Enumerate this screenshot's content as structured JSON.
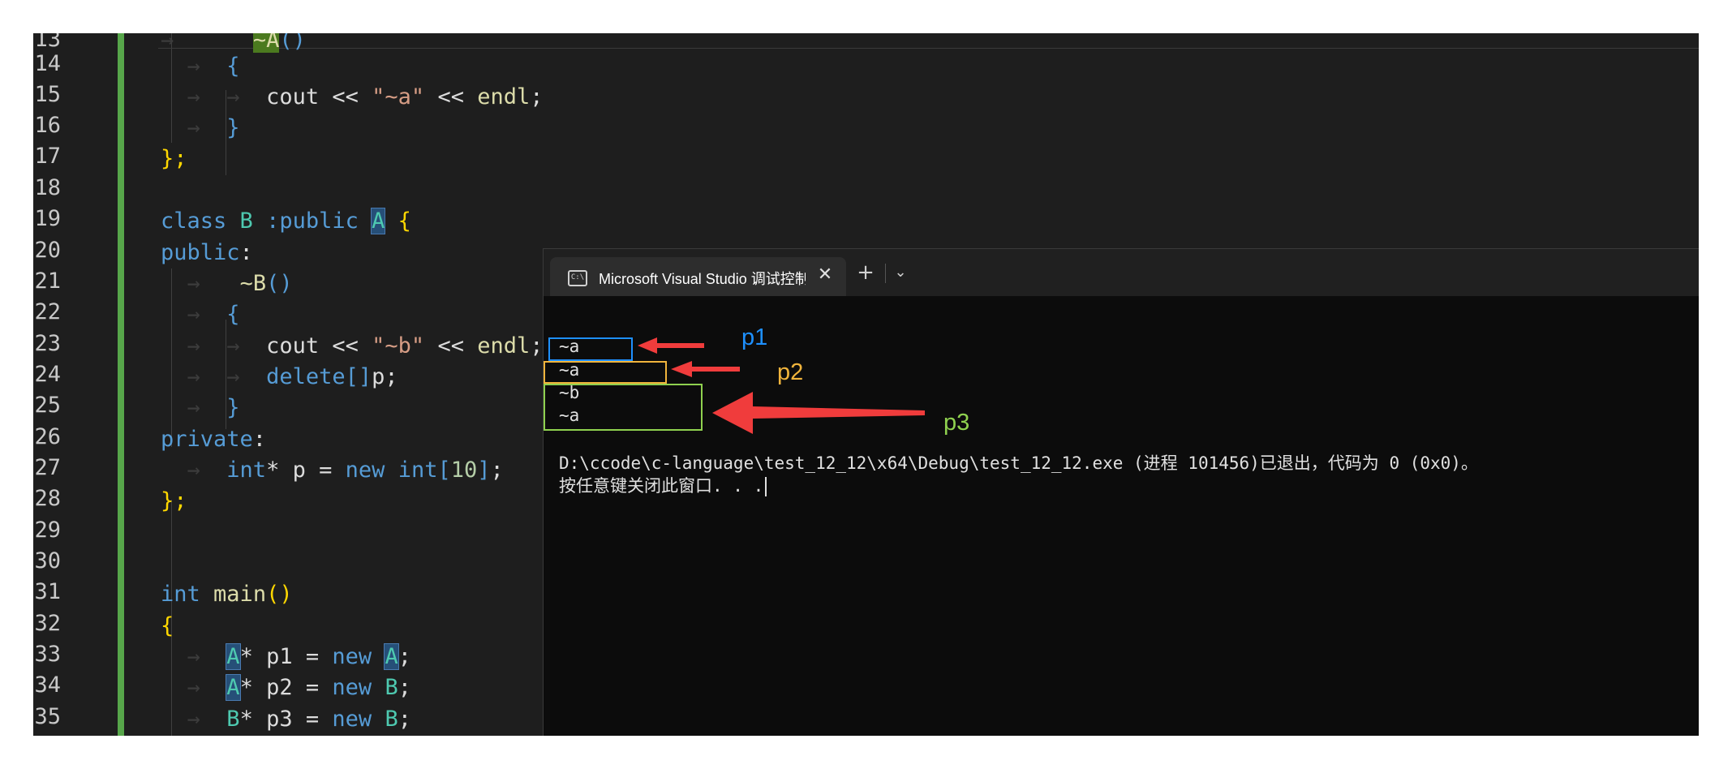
{
  "editor": {
    "line_numbers": [
      "13",
      "14",
      "15",
      "16",
      "17",
      "18",
      "19",
      "20",
      "21",
      "22",
      "23",
      "24",
      "25",
      "26",
      "27",
      "28",
      "29",
      "30",
      "31",
      "32",
      "33",
      "34",
      "35"
    ],
    "tokens": {
      "dtor_a": "~A",
      "cout": "cout",
      "shl": "<<",
      "str_a": "\"~a\"",
      "endl": "endl",
      "semi": ";",
      "class_kw": "class",
      "B": "B",
      "A": "A",
      "colon_public": ":public",
      "public_label": "public",
      "private_label": "private",
      "colon": ":",
      "dtor_b": "~B",
      "str_b": "\"~b\"",
      "delete_kw": "delete",
      "delete_rest": "p;",
      "int_kw": "int",
      "star": "*",
      "p": "p",
      "eq": "=",
      "new_kw": "new",
      "ten": "10",
      "main": "main",
      "p1": "p1",
      "p2": "p2",
      "p3": "p3",
      "lbrace": "{",
      "rbrace": "}",
      "rbrace_semi": "};",
      "parens": "()",
      "lbracket": "[",
      "rbracket": "]",
      "brackets": "[]",
      "indent_glyph": "→"
    }
  },
  "terminal": {
    "tab_title": "Microsoft Visual Studio 调试控制台",
    "tab_icon_label": "C:\\",
    "close_glyph": "✕",
    "new_tab_glyph": "+",
    "dropdown_glyph": "⌄",
    "output_lines": [
      "~a",
      "~a",
      "~b",
      "~a"
    ],
    "exit_message": "D:\\ccode\\c-language\\test_12_12\\x64\\Debug\\test_12_12.exe (进程 101456)已退出，代码为 0 (0x0)。",
    "press_key": "按任意键关闭此窗口. . ."
  },
  "annotations": [
    {
      "label": "p1",
      "color": "#1e90ff"
    },
    {
      "label": "p2",
      "color": "#f0b43c"
    },
    {
      "label": "p3",
      "color": "#8fd14f"
    }
  ],
  "arrow_color": "#f03c3c"
}
